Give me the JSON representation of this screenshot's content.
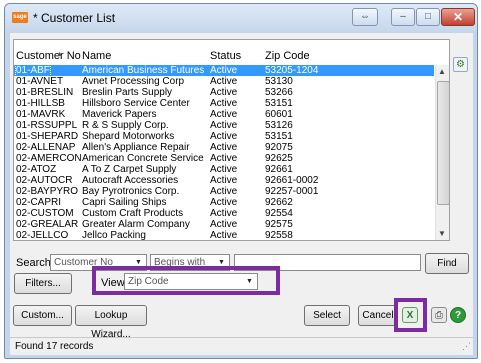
{
  "window": {
    "title": "* Customer List",
    "logo_text": "sage",
    "restore_glyph": "⇔",
    "min_glyph": "–",
    "max_glyph": "□",
    "close_glyph": "✕"
  },
  "list": {
    "columns": [
      "Customer No",
      "Name",
      "Status",
      "Zip Code"
    ],
    "rows": [
      [
        "01-ABF",
        "American Business Futures",
        "Active",
        "53205-1204"
      ],
      [
        "01-AVNET",
        "Avnet Processing Corp",
        "Active",
        "53130"
      ],
      [
        "01-BRESLIN",
        "Breslin Parts Supply",
        "Active",
        "53266"
      ],
      [
        "01-HILLSB",
        "Hillsboro Service Center",
        "Active",
        "53151"
      ],
      [
        "01-MAVRK",
        "Maverick Papers",
        "Active",
        "60601"
      ],
      [
        "01-RSSUPPL",
        "R & S Supply Corp.",
        "Active",
        "53126"
      ],
      [
        "01-SHEPARD",
        "Shepard Motorworks",
        "Active",
        "53151"
      ],
      [
        "02-ALLENAP",
        "Allen's Appliance Repair",
        "Active",
        "92075"
      ],
      [
        "02-AMERCON",
        "American Concrete Service",
        "Active",
        "92625"
      ],
      [
        "02-ATOZ",
        "A To Z Carpet Supply",
        "Active",
        "92661"
      ],
      [
        "02-AUTOCR",
        "Autocraft Accessories",
        "Active",
        "92661-0002"
      ],
      [
        "02-BAYPYRO",
        "Bay Pyrotronics Corp.",
        "Active",
        "92257-0001"
      ],
      [
        "02-CAPRI",
        "Capri Sailing Ships",
        "Active",
        "92662"
      ],
      [
        "02-CUSTOM",
        "Custom Craft Products",
        "Active",
        "92554"
      ],
      [
        "02-GREALAR",
        "Greater Alarm Company",
        "Active",
        "92575"
      ],
      [
        "02-JELLCO",
        "Jellco Packing",
        "Active",
        "92558"
      ]
    ],
    "selected_index": 0
  },
  "search": {
    "label": "Search",
    "field_value": "Customer No",
    "operator_value": "Begins with",
    "find_label": "Find",
    "filters_label": "Filters..."
  },
  "view": {
    "label": "View",
    "value": "Zip Code"
  },
  "buttons": {
    "custom": "Custom...",
    "lookup_wizard": "Lookup Wizard...",
    "select": "Select",
    "cancel": "Cancel"
  },
  "status": {
    "text": "Found 17 records"
  },
  "icons": {
    "side": "settings-icon",
    "export": "excel-export-icon",
    "print": "printer-icon",
    "help": "help-icon"
  },
  "colors": {
    "selection": "#3399ff",
    "highlight_box": "#7a2ca0",
    "title_accent": "#ef7b1a"
  }
}
